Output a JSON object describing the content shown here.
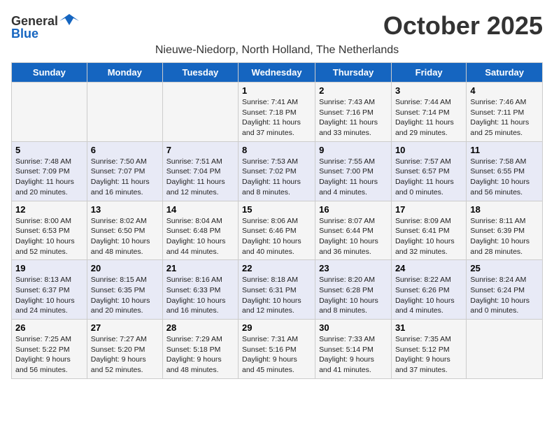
{
  "logo": {
    "general": "General",
    "blue": "Blue"
  },
  "title": "October 2025",
  "location": "Nieuwe-Niedorp, North Holland, The Netherlands",
  "days_of_week": [
    "Sunday",
    "Monday",
    "Tuesday",
    "Wednesday",
    "Thursday",
    "Friday",
    "Saturday"
  ],
  "weeks": [
    [
      {
        "day": "",
        "info": ""
      },
      {
        "day": "",
        "info": ""
      },
      {
        "day": "",
        "info": ""
      },
      {
        "day": "1",
        "info": "Sunrise: 7:41 AM\nSunset: 7:18 PM\nDaylight: 11 hours and 37 minutes."
      },
      {
        "day": "2",
        "info": "Sunrise: 7:43 AM\nSunset: 7:16 PM\nDaylight: 11 hours and 33 minutes."
      },
      {
        "day": "3",
        "info": "Sunrise: 7:44 AM\nSunset: 7:14 PM\nDaylight: 11 hours and 29 minutes."
      },
      {
        "day": "4",
        "info": "Sunrise: 7:46 AM\nSunset: 7:11 PM\nDaylight: 11 hours and 25 minutes."
      }
    ],
    [
      {
        "day": "5",
        "info": "Sunrise: 7:48 AM\nSunset: 7:09 PM\nDaylight: 11 hours and 20 minutes."
      },
      {
        "day": "6",
        "info": "Sunrise: 7:50 AM\nSunset: 7:07 PM\nDaylight: 11 hours and 16 minutes."
      },
      {
        "day": "7",
        "info": "Sunrise: 7:51 AM\nSunset: 7:04 PM\nDaylight: 11 hours and 12 minutes."
      },
      {
        "day": "8",
        "info": "Sunrise: 7:53 AM\nSunset: 7:02 PM\nDaylight: 11 hours and 8 minutes."
      },
      {
        "day": "9",
        "info": "Sunrise: 7:55 AM\nSunset: 7:00 PM\nDaylight: 11 hours and 4 minutes."
      },
      {
        "day": "10",
        "info": "Sunrise: 7:57 AM\nSunset: 6:57 PM\nDaylight: 11 hours and 0 minutes."
      },
      {
        "day": "11",
        "info": "Sunrise: 7:58 AM\nSunset: 6:55 PM\nDaylight: 10 hours and 56 minutes."
      }
    ],
    [
      {
        "day": "12",
        "info": "Sunrise: 8:00 AM\nSunset: 6:53 PM\nDaylight: 10 hours and 52 minutes."
      },
      {
        "day": "13",
        "info": "Sunrise: 8:02 AM\nSunset: 6:50 PM\nDaylight: 10 hours and 48 minutes."
      },
      {
        "day": "14",
        "info": "Sunrise: 8:04 AM\nSunset: 6:48 PM\nDaylight: 10 hours and 44 minutes."
      },
      {
        "day": "15",
        "info": "Sunrise: 8:06 AM\nSunset: 6:46 PM\nDaylight: 10 hours and 40 minutes."
      },
      {
        "day": "16",
        "info": "Sunrise: 8:07 AM\nSunset: 6:44 PM\nDaylight: 10 hours and 36 minutes."
      },
      {
        "day": "17",
        "info": "Sunrise: 8:09 AM\nSunset: 6:41 PM\nDaylight: 10 hours and 32 minutes."
      },
      {
        "day": "18",
        "info": "Sunrise: 8:11 AM\nSunset: 6:39 PM\nDaylight: 10 hours and 28 minutes."
      }
    ],
    [
      {
        "day": "19",
        "info": "Sunrise: 8:13 AM\nSunset: 6:37 PM\nDaylight: 10 hours and 24 minutes."
      },
      {
        "day": "20",
        "info": "Sunrise: 8:15 AM\nSunset: 6:35 PM\nDaylight: 10 hours and 20 minutes."
      },
      {
        "day": "21",
        "info": "Sunrise: 8:16 AM\nSunset: 6:33 PM\nDaylight: 10 hours and 16 minutes."
      },
      {
        "day": "22",
        "info": "Sunrise: 8:18 AM\nSunset: 6:31 PM\nDaylight: 10 hours and 12 minutes."
      },
      {
        "day": "23",
        "info": "Sunrise: 8:20 AM\nSunset: 6:28 PM\nDaylight: 10 hours and 8 minutes."
      },
      {
        "day": "24",
        "info": "Sunrise: 8:22 AM\nSunset: 6:26 PM\nDaylight: 10 hours and 4 minutes."
      },
      {
        "day": "25",
        "info": "Sunrise: 8:24 AM\nSunset: 6:24 PM\nDaylight: 10 hours and 0 minutes."
      }
    ],
    [
      {
        "day": "26",
        "info": "Sunrise: 7:25 AM\nSunset: 5:22 PM\nDaylight: 9 hours and 56 minutes."
      },
      {
        "day": "27",
        "info": "Sunrise: 7:27 AM\nSunset: 5:20 PM\nDaylight: 9 hours and 52 minutes."
      },
      {
        "day": "28",
        "info": "Sunrise: 7:29 AM\nSunset: 5:18 PM\nDaylight: 9 hours and 48 minutes."
      },
      {
        "day": "29",
        "info": "Sunrise: 7:31 AM\nSunset: 5:16 PM\nDaylight: 9 hours and 45 minutes."
      },
      {
        "day": "30",
        "info": "Sunrise: 7:33 AM\nSunset: 5:14 PM\nDaylight: 9 hours and 41 minutes."
      },
      {
        "day": "31",
        "info": "Sunrise: 7:35 AM\nSunset: 5:12 PM\nDaylight: 9 hours and 37 minutes."
      },
      {
        "day": "",
        "info": ""
      }
    ]
  ]
}
